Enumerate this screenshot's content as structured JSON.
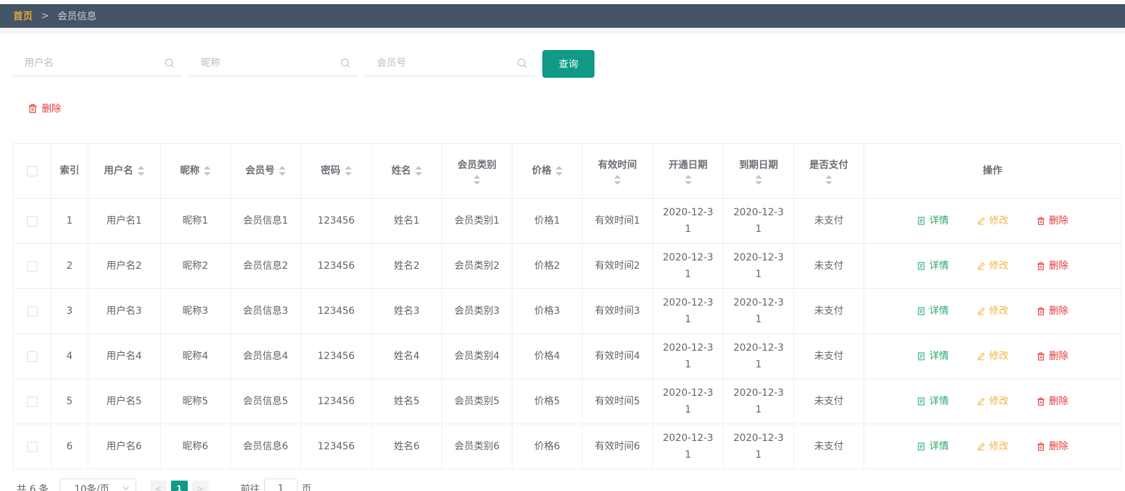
{
  "breadcrumb": {
    "home": "首页",
    "separator": ">",
    "current": "会员信息"
  },
  "search": {
    "username_placeholder": "用户名",
    "nickname_placeholder": "昵称",
    "member_no_placeholder": "会员号",
    "query_label": "查询"
  },
  "toolbar": {
    "delete_label": "删除"
  },
  "table": {
    "headers": {
      "index": "索引",
      "username": "用户名",
      "nickname": "昵称",
      "member_no": "会员号",
      "password": "密码",
      "name": "姓名",
      "member_type": "会员类别",
      "price": "价格",
      "valid_time": "有效时间",
      "open_date": "开通日期",
      "expire_date": "到期日期",
      "paid": "是否支付",
      "actions": "操作"
    },
    "rows": [
      {
        "index": "1",
        "username": "用户名1",
        "nickname": "昵称1",
        "member_no": "会员信息1",
        "password": "123456",
        "name": "姓名1",
        "member_type": "会员类别1",
        "price": "价格1",
        "valid_time": "有效时间1",
        "open_date": "2020-12-31",
        "expire_date": "2020-12-31",
        "paid": "未支付"
      },
      {
        "index": "2",
        "username": "用户名2",
        "nickname": "昵称2",
        "member_no": "会员信息2",
        "password": "123456",
        "name": "姓名2",
        "member_type": "会员类别2",
        "price": "价格2",
        "valid_time": "有效时间2",
        "open_date": "2020-12-31",
        "expire_date": "2020-12-31",
        "paid": "未支付"
      },
      {
        "index": "3",
        "username": "用户名3",
        "nickname": "昵称3",
        "member_no": "会员信息3",
        "password": "123456",
        "name": "姓名3",
        "member_type": "会员类别3",
        "price": "价格3",
        "valid_time": "有效时间3",
        "open_date": "2020-12-31",
        "expire_date": "2020-12-31",
        "paid": "未支付"
      },
      {
        "index": "4",
        "username": "用户名4",
        "nickname": "昵称4",
        "member_no": "会员信息4",
        "password": "123456",
        "name": "姓名4",
        "member_type": "会员类别4",
        "price": "价格4",
        "valid_time": "有效时间4",
        "open_date": "2020-12-31",
        "expire_date": "2020-12-31",
        "paid": "未支付"
      },
      {
        "index": "5",
        "username": "用户名5",
        "nickname": "昵称5",
        "member_no": "会员信息5",
        "password": "123456",
        "name": "姓名5",
        "member_type": "会员类别5",
        "price": "价格5",
        "valid_time": "有效时间5",
        "open_date": "2020-12-31",
        "expire_date": "2020-12-31",
        "paid": "未支付"
      },
      {
        "index": "6",
        "username": "用户名6",
        "nickname": "昵称6",
        "member_no": "会员信息6",
        "password": "123456",
        "name": "姓名6",
        "member_type": "会员类别6",
        "price": "价格6",
        "valid_time": "有效时间6",
        "open_date": "2020-12-31",
        "expire_date": "2020-12-31",
        "paid": "未支付"
      }
    ],
    "actions": {
      "detail": "详情",
      "edit": "修改",
      "remove": "删除"
    }
  },
  "pagination": {
    "total": "共 6 条",
    "page_size": "10条/页",
    "prev": "<",
    "current_page": "1",
    "next": ">",
    "goto_label": "前往",
    "goto_value": "1",
    "page_suffix": "页"
  },
  "colors": {
    "header_bg": "#425466",
    "accent": "#0e9a86",
    "danger": "#e33a3a",
    "success": "#2aa86a",
    "warning": "#f2b54a",
    "breadcrumb_home": "#e6a23c"
  }
}
